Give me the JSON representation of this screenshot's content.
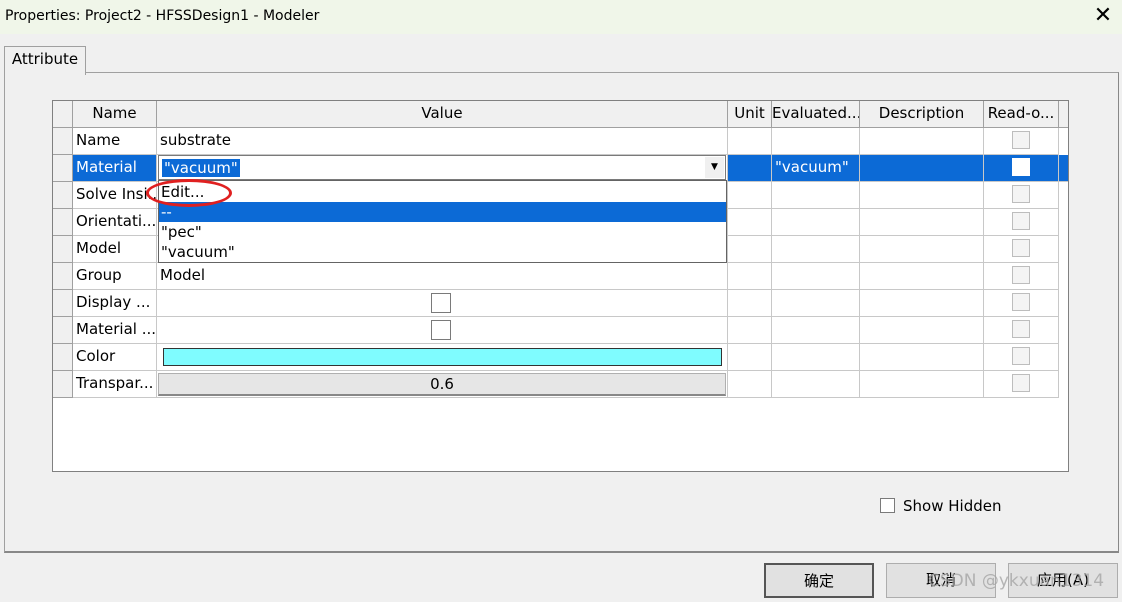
{
  "window": {
    "title": "Properties: Project2 - HFSSDesign1 - Modeler",
    "close_glyph": "✕"
  },
  "tabs": [
    {
      "label": "Attribute"
    }
  ],
  "grid": {
    "columns": [
      "Name",
      "Value",
      "Unit",
      "Evaluated...",
      "Description",
      "Read-o..."
    ],
    "rows": [
      {
        "name": "Name",
        "value": "substrate",
        "evaluated": "",
        "read_only": false
      },
      {
        "name": "Material",
        "value": "\"vacuum\"",
        "evaluated": "\"vacuum\"",
        "read_only": false,
        "selected": true
      },
      {
        "name": "Solve Insi...",
        "value": "",
        "evaluated": "",
        "read_only": false
      },
      {
        "name": "Orientati...",
        "value": "",
        "evaluated": "",
        "read_only": false
      },
      {
        "name": "Model",
        "value": "",
        "evaluated": "",
        "read_only": false
      },
      {
        "name": "Group",
        "value": "Model",
        "evaluated": "",
        "read_only": false
      },
      {
        "name": "Display ...",
        "value_checkbox": false,
        "evaluated": "",
        "read_only": false
      },
      {
        "name": "Material ...",
        "value_checkbox": false,
        "evaluated": "",
        "read_only": false
      },
      {
        "name": "Color",
        "value_color": "#7ffcff",
        "evaluated": "",
        "read_only": false
      },
      {
        "name": "Transpar...",
        "value": "0.6",
        "evaluated": "",
        "read_only": false
      }
    ]
  },
  "material_combo": {
    "value": "\"vacuum\"",
    "options": [
      "Edit...",
      "--",
      "\"pec\"",
      "\"vacuum\""
    ],
    "highlighted_option": "--"
  },
  "show_hidden": {
    "label": "Show Hidden",
    "checked": false
  },
  "buttons": {
    "ok": "确定",
    "cancel": "取消",
    "apply": "应用(A)"
  },
  "watermark": "CSDN @ykxuan1314",
  "colors": {
    "selection": "#0c6ad6",
    "annotation": "#e02020",
    "color_value": "#7ffcff"
  }
}
